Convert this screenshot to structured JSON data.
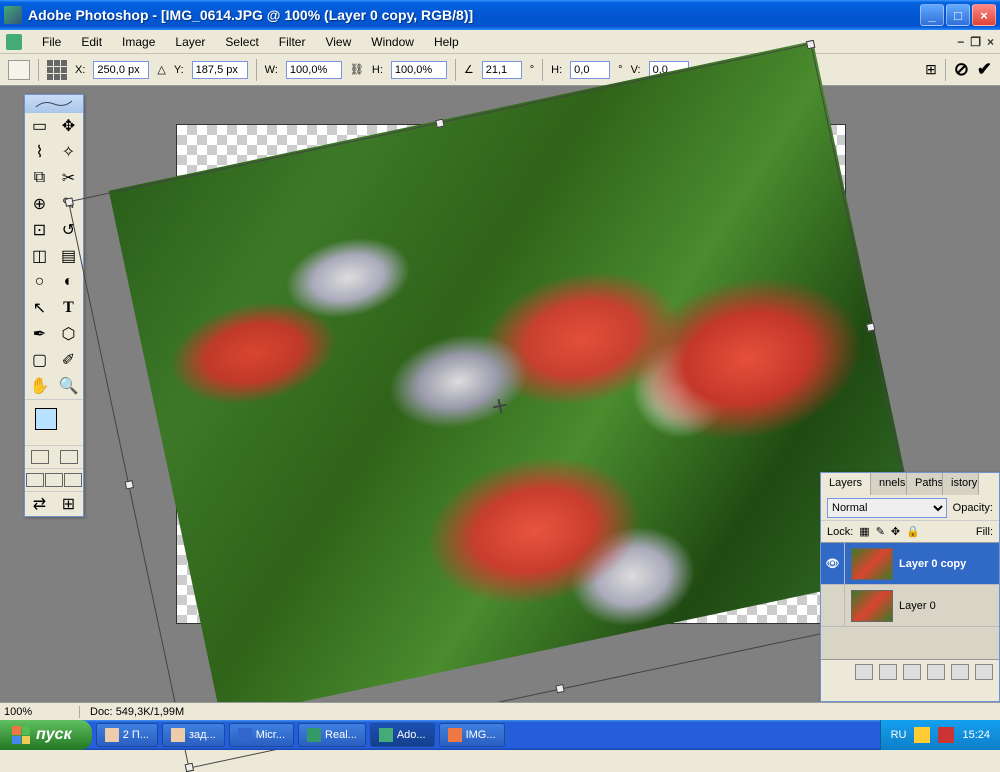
{
  "titlebar": {
    "text": "Adobe Photoshop - [IMG_0614.JPG @ 100% (Layer 0 copy, RGB/8)]"
  },
  "menu": {
    "items": [
      "File",
      "Edit",
      "Image",
      "Layer",
      "Select",
      "Filter",
      "View",
      "Window",
      "Help"
    ]
  },
  "options": {
    "x_label": "X:",
    "x": "250,0 px",
    "y_label": "Y:",
    "y": "187,5 px",
    "w_label": "W:",
    "w": "100,0%",
    "h_label": "H:",
    "h": "100,0%",
    "angle": "21,1",
    "h2_label": "H:",
    "h2": "0,0",
    "v_label": "V:",
    "v": "0,0",
    "deg": "°"
  },
  "status": {
    "zoom": "100%",
    "doc_label": "Doc:",
    "doc": "549,3K/1,99M"
  },
  "layers": {
    "tabs": [
      "Layers",
      "nnels",
      "Paths",
      "istory"
    ],
    "blend": "Normal",
    "opacity_label": "Opacity:",
    "lock_label": "Lock:",
    "fill_label": "Fill:",
    "items": [
      {
        "name": "Layer 0 copy",
        "visible": true,
        "selected": true
      },
      {
        "name": "Layer 0",
        "visible": false,
        "selected": false
      }
    ]
  },
  "taskbar": {
    "start": "пуск",
    "items": [
      {
        "label": "2 П..."
      },
      {
        "label": "зад..."
      },
      {
        "label": "Micr..."
      },
      {
        "label": "Real..."
      },
      {
        "label": "Ado...",
        "active": true
      },
      {
        "label": "IMG..."
      }
    ],
    "lang": "RU",
    "time": "15:24"
  },
  "colors": {
    "fg": "#b8e0ff",
    "bg": "#ffffff"
  }
}
